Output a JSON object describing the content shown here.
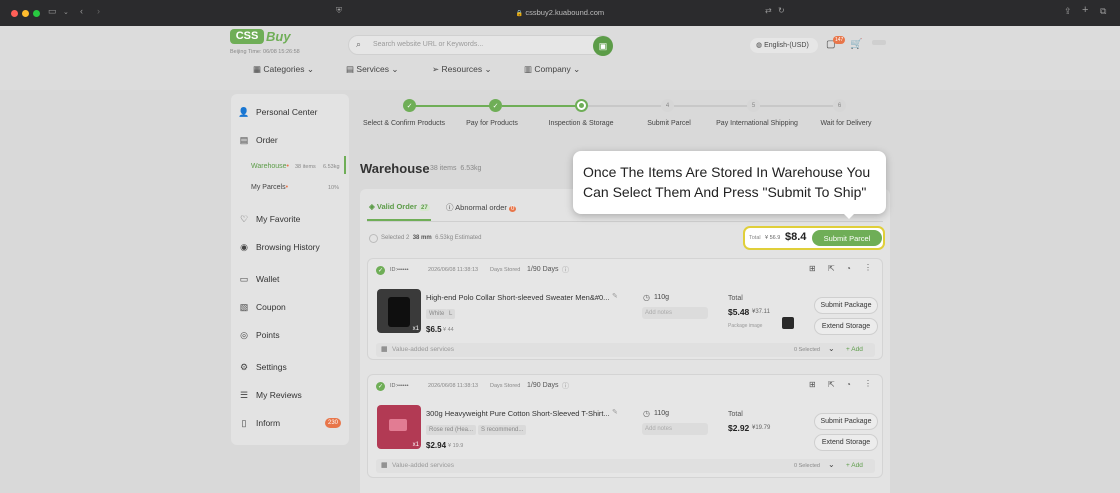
{
  "browser": {
    "url": "cssbuy2.kuabound.com"
  },
  "header": {
    "logo_text": "CSS",
    "logo_suffix": "Buy",
    "beijing_time": "Beijing Time: 06/08 15:26:58",
    "search_placeholder": "Search website URL or Keywords...",
    "language": "English-(USD)",
    "msg_badge": "147",
    "nav": [
      "Categories",
      "Services",
      "Resources",
      "Company"
    ]
  },
  "sidebar": {
    "items": [
      {
        "label": "Personal Center",
        "icon": "user-icon"
      },
      {
        "label": "Order",
        "icon": "order-icon"
      },
      {
        "label": "My Favorite",
        "icon": "heart-icon"
      },
      {
        "label": "Browsing History",
        "icon": "eye-icon"
      },
      {
        "label": "Wallet",
        "icon": "wallet-icon"
      },
      {
        "label": "Coupon",
        "icon": "coupon-icon"
      },
      {
        "label": "Points",
        "icon": "points-icon"
      },
      {
        "label": "Settings",
        "icon": "settings-icon"
      },
      {
        "label": "My Reviews",
        "icon": "reviews-icon"
      },
      {
        "label": "Inform",
        "icon": "inform-icon"
      }
    ],
    "order_sub": [
      {
        "label": "Warehouse",
        "meta1": "38 items",
        "meta2": "6.53kg"
      },
      {
        "label": "My Parcels",
        "meta1": "",
        "meta2": "10%"
      }
    ],
    "inform_badge": "230"
  },
  "steps": [
    {
      "label": "Select & Confirm Products",
      "state": "done"
    },
    {
      "label": "Pay for Products",
      "state": "done"
    },
    {
      "label": "Inspection & Storage",
      "state": "current"
    },
    {
      "label": "Submit Parcel",
      "state": "4"
    },
    {
      "label": "Pay International Shipping",
      "state": "5"
    },
    {
      "label": "Wait for Delivery",
      "state": "6"
    }
  ],
  "warehouse": {
    "title": "Warehouse",
    "items": "38 items",
    "weight": "6.53kg",
    "tab_valid": "Valid Order",
    "tab_valid_count": "27",
    "tab_abnormal": "Abnormal order",
    "tab_abnormal_count": "0",
    "selected_label": "Selected 2",
    "selected_items": "38 mm",
    "selected_weight": "6.53kg Estimated",
    "total_label": "Total",
    "total_old": "¥ 56.9",
    "total_price": "$8.4",
    "submit_label": "Submit Parcel"
  },
  "tooltip": {
    "text": "Once The Items Are Stored In Warehouse You Can Select Them And Press \"Submit To Ship\""
  },
  "orders": [
    {
      "id": "ID:••••••",
      "date": "2026/06/08 11:38:13",
      "days_label": "Days Stored",
      "days": "1/90 Days",
      "name": "High-end Polo Collar Short-sleeved Sweater Men&#0...",
      "opt1": "White",
      "opt2": "L",
      "price": "$6.5",
      "price_cny": "¥ 44",
      "weight": "110g",
      "weight_ph": "Add notes",
      "total_label": "Total",
      "total": "$5.48",
      "total_cny": "¥37.11",
      "pkg": "Package image",
      "qty": "x1",
      "btn1": "Submit Package",
      "btn2": "Extend Storage",
      "vas": "Value-added services",
      "vas_count": "0 Selected",
      "add": "Add"
    },
    {
      "id": "ID:••••••",
      "date": "2026/06/08 11:38:13",
      "days_label": "Days Stored",
      "days": "1/90 Days",
      "name": "300g Heavyweight Pure Cotton Short-Sleeved T-Shirt...",
      "opt1": "Rose red (Hea...",
      "opt2": "S recommend...",
      "price": "$2.94",
      "price_cny": "¥ 19.9",
      "weight": "110g",
      "weight_ph": "Add notes",
      "total_label": "Total",
      "total": "$2.92",
      "total_cny": "¥19.79",
      "pkg": "",
      "qty": "x1",
      "btn1": "Submit Package",
      "btn2": "Extend Storage",
      "vas": "Value-added services",
      "vas_count": "0 Selected",
      "add": "Add"
    }
  ],
  "colors": {
    "brand": "#6fae57",
    "highlight": "#e0cf3a",
    "badge": "#e8764a"
  }
}
